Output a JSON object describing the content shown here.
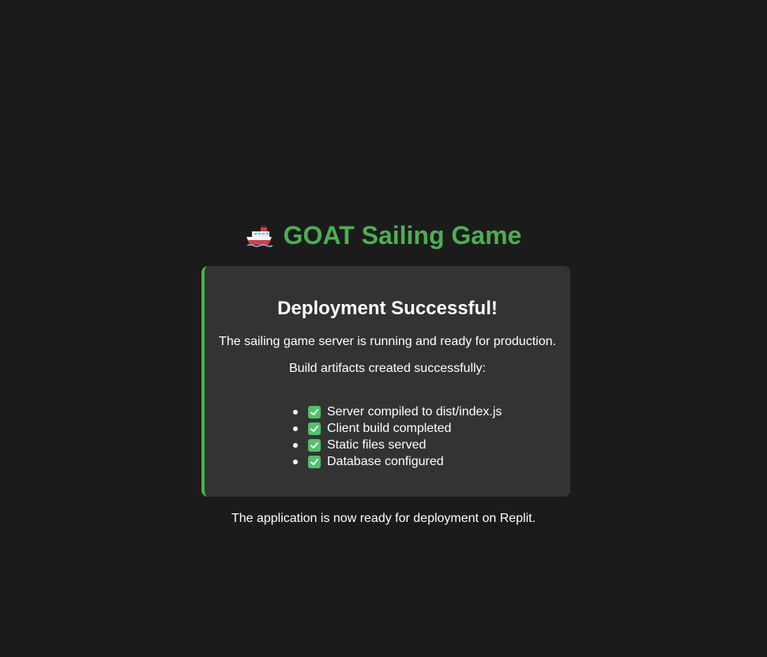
{
  "header": {
    "icon": "ship-icon",
    "title": "GOAT Sailing Game"
  },
  "card": {
    "heading": "Deployment Successful!",
    "status_text": "The sailing game server is running and ready for production.",
    "artifacts_intro": "Build artifacts created successfully:",
    "artifacts": [
      {
        "icon": "check-mark-icon",
        "label": "Server compiled to dist/index.js"
      },
      {
        "icon": "check-mark-icon",
        "label": "Client build completed"
      },
      {
        "icon": "check-mark-icon",
        "label": "Static files served"
      },
      {
        "icon": "check-mark-icon",
        "label": "Database configured"
      }
    ]
  },
  "footer": {
    "text": "The application is now ready for deployment on Replit."
  },
  "colors": {
    "background": "#1b1b1b",
    "card": "#333333",
    "accent": "#4caf50",
    "check": "#4fc26b",
    "text": "#ffffff"
  }
}
